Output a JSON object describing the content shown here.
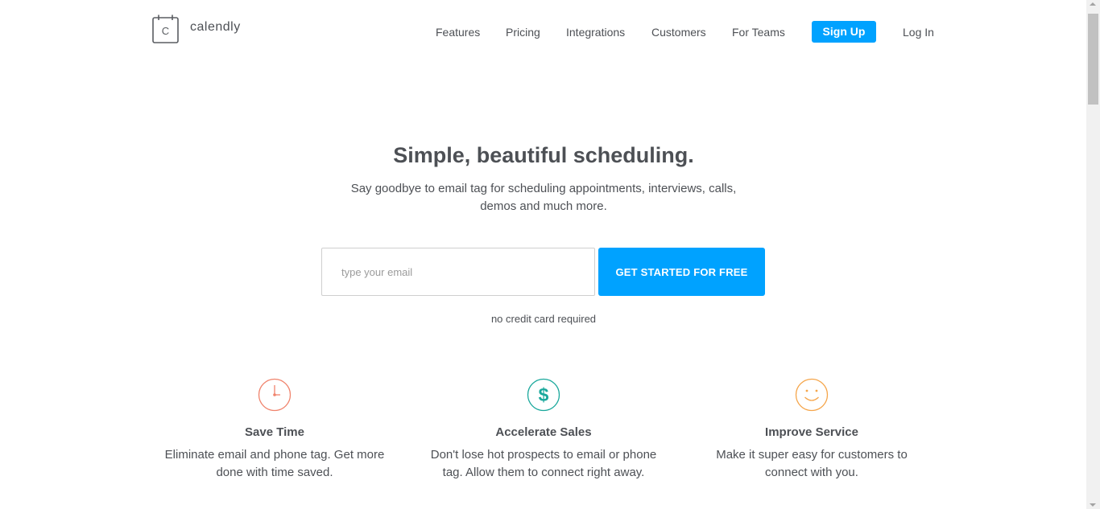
{
  "brand": {
    "logo_letter": "C",
    "name": "calendly",
    "accent_color": "#00a2ff"
  },
  "nav": {
    "items": [
      {
        "label": "Features"
      },
      {
        "label": "Pricing"
      },
      {
        "label": "Integrations"
      },
      {
        "label": "Customers"
      },
      {
        "label": "For Teams"
      }
    ],
    "signup_label": "Sign Up",
    "login_label": "Log In"
  },
  "hero": {
    "title": "Simple, beautiful scheduling.",
    "subtitle": "Say goodbye to email tag for scheduling appointments, interviews, calls, demos and much more.",
    "email_placeholder": "type your email",
    "email_value": "",
    "cta_label": "GET STARTED FOR FREE",
    "note": "no credit card required"
  },
  "features": [
    {
      "icon": "clock-icon",
      "icon_color": "#f0836c",
      "title": "Save Time",
      "description": "Eliminate email and phone tag. Get more done with time saved."
    },
    {
      "icon": "dollar-icon",
      "icon_color": "#1aa89c",
      "title": "Accelerate Sales",
      "description": "Don't lose hot prospects to email or phone tag. Allow them to connect right away."
    },
    {
      "icon": "smiley-icon",
      "icon_color": "#f5a54a",
      "title": "Improve Service",
      "description": "Make it super easy for customers to connect with you."
    }
  ]
}
